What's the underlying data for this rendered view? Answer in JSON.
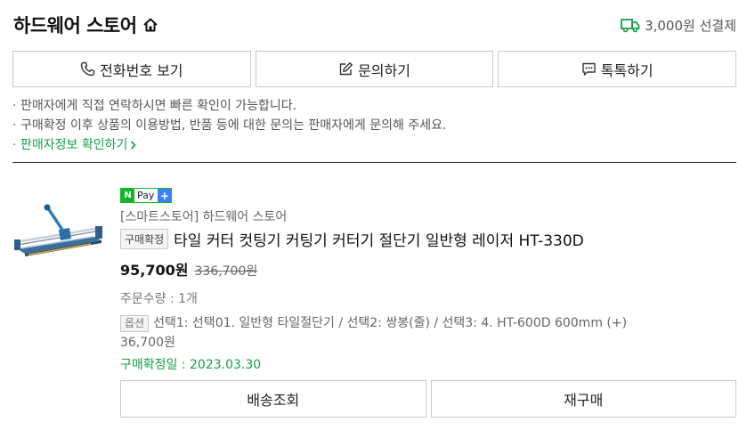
{
  "header": {
    "store_name": "하드웨어 스토어",
    "shipping_text": "3,000원 선결제",
    "accent_color": "#14a044"
  },
  "contact": {
    "phone_label": "전화번호 보기",
    "inquiry_label": "문의하기",
    "talk_label": "톡톡하기"
  },
  "notes": {
    "line1": "판매자에게 직접 연락하시면 빠른 확인이 가능합니다.",
    "line2": "구매확정 이후 상품의 이용방법, 반품 등에 대한 문의는 판매자에게 문의해 주세요.",
    "link": "판매자정보 확인하기"
  },
  "order": {
    "npay_n": "N",
    "npay_pay": "Pay",
    "npay_plus": "+",
    "seller": "[스마트스토어] 하드웨어 스토어",
    "status_badge": "구매확정",
    "product_title": "타일 커터 컷팅기 커팅기 커터기 절단기 일반형 레이저 HT-330D",
    "price": "95,700원",
    "original_price": "336,700원",
    "quantity": "주문수량 : 1개",
    "option_badge": "옵션",
    "option_text": "선택1: 선택01. 일반형 타일절단기 / 선택2: 쌍봉(줄) / 선택3: 4. HT-600D 600mm (+)",
    "option_price": "36,700원",
    "confirm_date": "구매확정일 : 2023.03.30",
    "tracking_label": "배송조회",
    "reorder_label": "재구매"
  }
}
